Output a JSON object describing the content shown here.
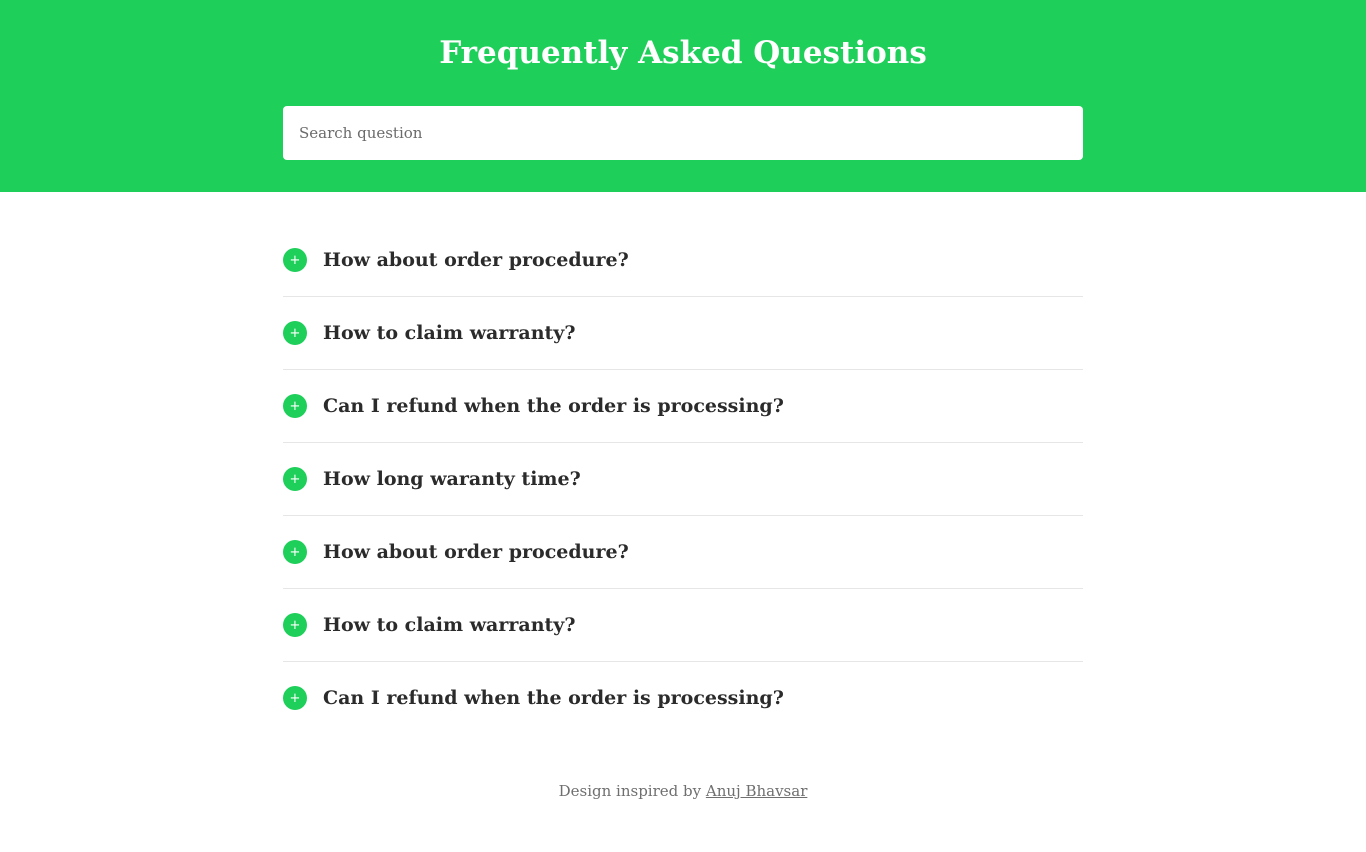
{
  "header": {
    "title": "Frequently Asked Questions",
    "search_placeholder": "Search question",
    "search_value": ""
  },
  "faq": {
    "items": [
      {
        "question": "How about order procedure?",
        "icon": "plus-icon"
      },
      {
        "question": "How to claim warranty?",
        "icon": "plus-icon"
      },
      {
        "question": "Can I refund when the order is processing?",
        "icon": "plus-icon"
      },
      {
        "question": "How long waranty time?",
        "icon": "plus-icon"
      },
      {
        "question": "How about order procedure?",
        "icon": "plus-icon"
      },
      {
        "question": "How to claim warranty?",
        "icon": "plus-icon"
      },
      {
        "question": "Can I refund when the order is processing?",
        "icon": "plus-icon"
      }
    ],
    "icon_glyph": "+"
  },
  "footer": {
    "prefix": "Design inspired by ",
    "link_text": "Anuj Bhavsar"
  },
  "colors": {
    "accent": "#1ecf5a",
    "text": "#2b2b2b",
    "muted": "#6f6f6f",
    "divider": "#e6e6e6"
  }
}
